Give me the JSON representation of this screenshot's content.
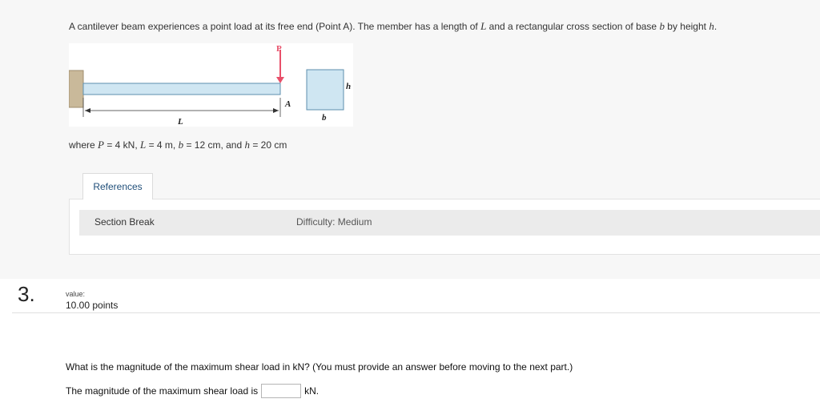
{
  "problem": {
    "intro_1": "A cantilever beam experiences a point load at its free end (Point A). The member has a length of ",
    "var_L": "L",
    "intro_2": " and a rectangular cross section of base ",
    "var_b": "b",
    "intro_3": " by height ",
    "var_h": "h",
    "intro_4": ".",
    "figure": {
      "load_label": "P",
      "point_label": "A",
      "length_label": "L",
      "base_label": "b",
      "height_label": "h"
    },
    "where_prefix": "where ",
    "P_var": "P",
    "P_val": " = 4 kN, ",
    "L_var": "L",
    "L_val": " = 4 m, ",
    "b_var": "b",
    "b_val": " = 12 cm, and ",
    "h_var": "h",
    "h_val": " = 20 cm"
  },
  "references": {
    "tab_label": "References",
    "section_break": "Section Break",
    "difficulty": "Difficulty: Medium"
  },
  "question": {
    "number": "3.",
    "value_label": "value:",
    "value_amount": "10.00 points",
    "prompt": "What is the magnitude of the maximum shear load in kN? (You must provide an answer before moving to the next part.)",
    "answer_prefix": "The magnitude of the maximum shear load is",
    "answer_value": "",
    "answer_unit": "kN."
  },
  "colors": {
    "load_arrow": "#e8506a",
    "beam_fill": "#cfe6f2",
    "wall_fill": "#c9b99a",
    "link": "#1f4e79"
  }
}
